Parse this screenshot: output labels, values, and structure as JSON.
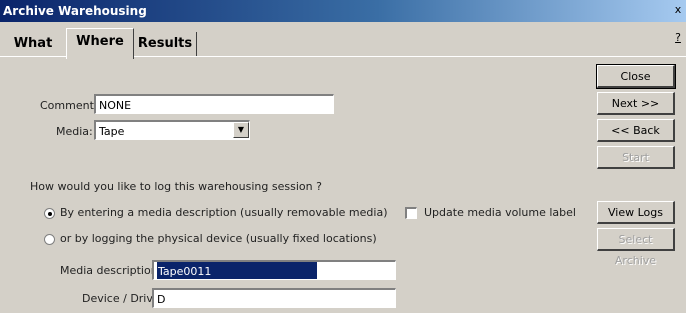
{
  "window": {
    "title": "Archive Warehousing",
    "close_glyph": "x",
    "help_glyph": "?"
  },
  "tabs": [
    {
      "label": "What",
      "active": false
    },
    {
      "label": "Where",
      "active": true
    },
    {
      "label": "Results",
      "active": false
    }
  ],
  "form": {
    "comment_label": "Comment:",
    "comment_value": "NONE",
    "media_label": "Media:",
    "media_value": "Tape",
    "question": "How would you like to log this warehousing session ?",
    "option_media_desc": "By entering a media description  (usually removable media)",
    "option_physical": "or by logging the physical device (usually fixed locations)",
    "selected_option": "media_desc",
    "update_label": "Update media volume label",
    "update_checked": false,
    "media_description_label": "Media description:",
    "media_description_value": "Tape0011",
    "device_label": "Device / Drive:",
    "device_value": "D"
  },
  "buttons": {
    "close": "Close",
    "next": "Next >>",
    "back": "<< Back",
    "start": "Start",
    "view_logs": "View Logs",
    "select_archive": "Select Archive"
  },
  "icons": {
    "dropdown": "chevron-down-icon"
  }
}
